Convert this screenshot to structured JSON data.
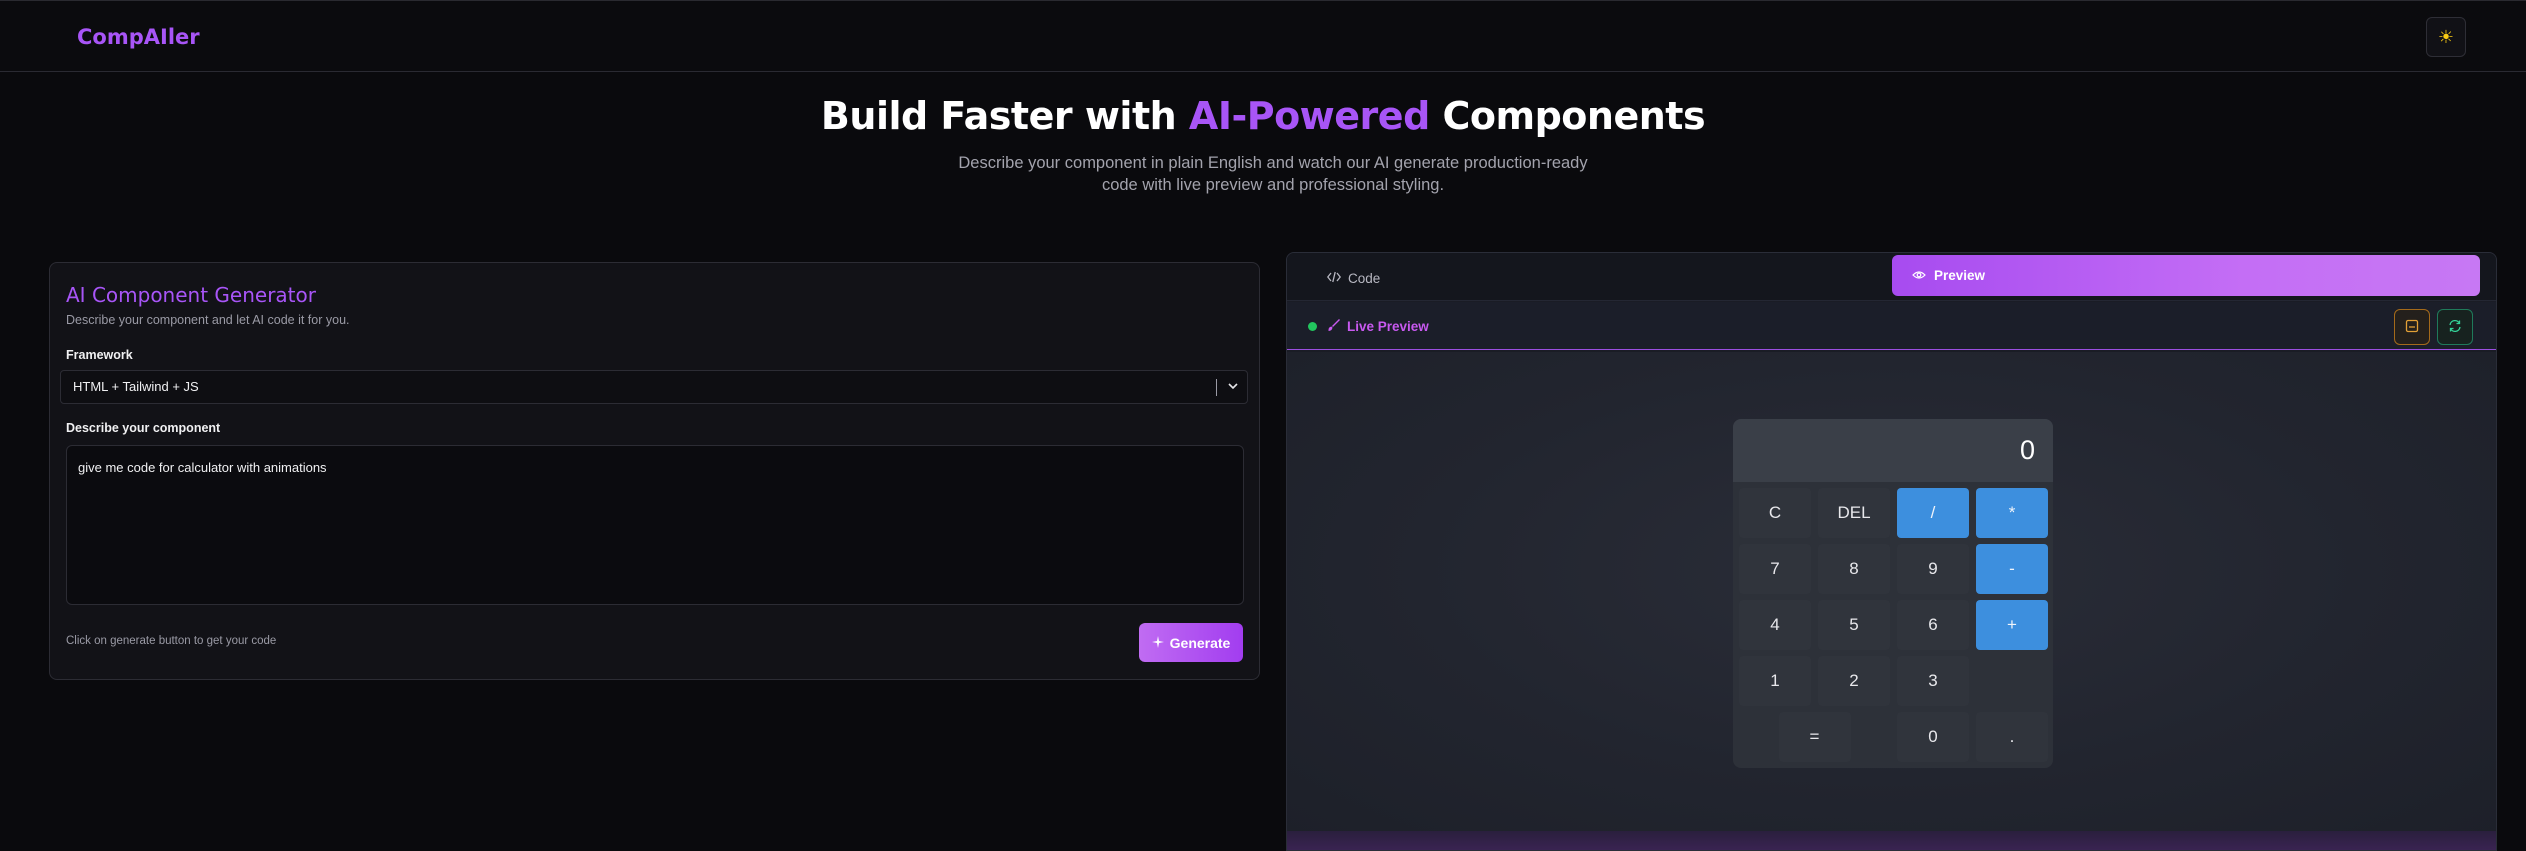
{
  "header": {
    "brand": "CompAIler",
    "theme_icon": "sun-icon"
  },
  "hero": {
    "title_pre": "Build Faster with ",
    "title_accent": "AI-Powered",
    "title_post": " Components",
    "subtitle": "Describe your component in plain English and watch our AI generate production-ready code with live preview and professional styling."
  },
  "generator": {
    "title": "AI Component Generator",
    "description": "Describe your component and let AI code it for you.",
    "framework_label": "Framework",
    "framework_value": "HTML + Tailwind + JS",
    "describe_label": "Describe your component",
    "prompt_value": "give me code for calculator with animations",
    "hint": "Click on generate button to get your code",
    "generate_label": "Generate"
  },
  "preview": {
    "tab_code": "Code",
    "tab_preview": "Preview",
    "active_tab": "Preview",
    "live_label": "Live Preview",
    "status_color": "#22c55e",
    "accent_color": "#a855f7"
  },
  "calculator": {
    "display": "0",
    "keys": [
      {
        "label": "C",
        "type": "fn"
      },
      {
        "label": "DEL",
        "type": "fn"
      },
      {
        "label": "/",
        "type": "op"
      },
      {
        "label": "*",
        "type": "op"
      },
      {
        "label": "7",
        "type": "num"
      },
      {
        "label": "8",
        "type": "num"
      },
      {
        "label": "9",
        "type": "num"
      },
      {
        "label": "-",
        "type": "op"
      },
      {
        "label": "4",
        "type": "num"
      },
      {
        "label": "5",
        "type": "num"
      },
      {
        "label": "6",
        "type": "num"
      },
      {
        "label": "+",
        "type": "op"
      },
      {
        "label": "1",
        "type": "num"
      },
      {
        "label": "2",
        "type": "num"
      },
      {
        "label": "3",
        "type": "num"
      },
      {
        "label": "=",
        "type": "eq"
      },
      {
        "label": "0",
        "type": "num"
      },
      {
        "label": ".",
        "type": "num"
      }
    ]
  }
}
